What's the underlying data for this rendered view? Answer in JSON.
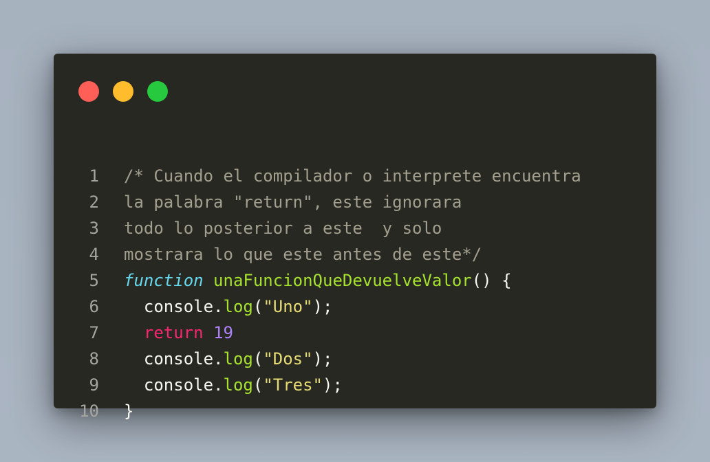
{
  "window": {
    "controls": [
      {
        "name": "close",
        "color": "#ff5f56"
      },
      {
        "name": "minimize",
        "color": "#ffbd2e"
      },
      {
        "name": "maximize",
        "color": "#27c93f"
      }
    ]
  },
  "code": {
    "language": "javascript",
    "theme": "monokai",
    "lines": [
      {
        "n": "1",
        "tokens": [
          {
            "t": "/* Cuando el compilador o interprete encuentra",
            "k": "comment"
          }
        ]
      },
      {
        "n": "2",
        "tokens": [
          {
            "t": "la palabra \"return\", este ignorara",
            "k": "comment"
          }
        ]
      },
      {
        "n": "3",
        "tokens": [
          {
            "t": "todo lo posterior a este  y solo",
            "k": "comment"
          }
        ]
      },
      {
        "n": "4",
        "tokens": [
          {
            "t": "mostrara lo que este antes de este*/",
            "k": "comment"
          }
        ]
      },
      {
        "n": "5",
        "tokens": [
          {
            "t": "function",
            "k": "storage"
          },
          {
            "t": " ",
            "k": "plain"
          },
          {
            "t": "unaFuncionQueDevuelveValor",
            "k": "fn"
          },
          {
            "t": "() {",
            "k": "plain"
          }
        ]
      },
      {
        "n": "6",
        "tokens": [
          {
            "t": "  console.",
            "k": "plain"
          },
          {
            "t": "log",
            "k": "fn"
          },
          {
            "t": "(",
            "k": "plain"
          },
          {
            "t": "\"Uno\"",
            "k": "str"
          },
          {
            "t": ");",
            "k": "plain"
          }
        ]
      },
      {
        "n": "7",
        "tokens": [
          {
            "t": "  ",
            "k": "plain"
          },
          {
            "t": "return",
            "k": "kw"
          },
          {
            "t": " ",
            "k": "plain"
          },
          {
            "t": "19",
            "k": "num"
          }
        ]
      },
      {
        "n": "8",
        "tokens": [
          {
            "t": "  console.",
            "k": "plain"
          },
          {
            "t": "log",
            "k": "fn"
          },
          {
            "t": "(",
            "k": "plain"
          },
          {
            "t": "\"Dos\"",
            "k": "str"
          },
          {
            "t": ");",
            "k": "plain"
          }
        ]
      },
      {
        "n": "9",
        "tokens": [
          {
            "t": "  console.",
            "k": "plain"
          },
          {
            "t": "log",
            "k": "fn"
          },
          {
            "t": "(",
            "k": "plain"
          },
          {
            "t": "\"Tres\"",
            "k": "str"
          },
          {
            "t": ");",
            "k": "plain"
          }
        ]
      },
      {
        "n": "10",
        "tokens": [
          {
            "t": "}",
            "k": "plain"
          }
        ]
      }
    ]
  }
}
